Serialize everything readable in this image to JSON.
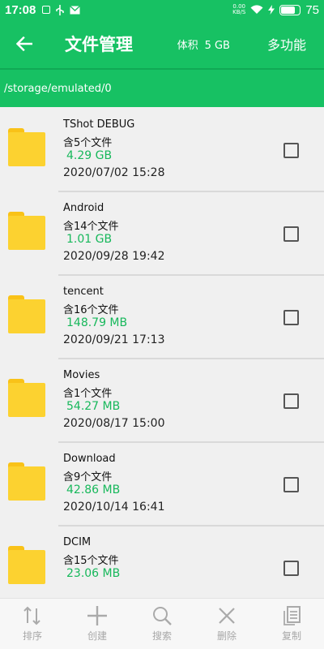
{
  "status_bar": {
    "time": "17:08",
    "net_speed_value": "0.00",
    "net_speed_unit": "KB/S",
    "battery_pct": "75",
    "battery_level": 0.75
  },
  "app_bar": {
    "title": "文件管理",
    "size_label": "体积",
    "size_value": "5 GB",
    "more_label": "多功能"
  },
  "path": "/storage/emulated/0",
  "files": [
    {
      "name": "TShot DEBUG",
      "count": "含5个文件",
      "size": "4.29 GB",
      "date": "2020/07/02 15:28"
    },
    {
      "name": "Android",
      "count": "含14个文件",
      "size": "1.01 GB",
      "date": "2020/09/28 19:42"
    },
    {
      "name": "tencent",
      "count": "含16个文件",
      "size": "148.79 MB",
      "date": "2020/09/21 17:13"
    },
    {
      "name": "Movies",
      "count": "含1个文件",
      "size": "54.27 MB",
      "date": "2020/08/17 15:00"
    },
    {
      "name": "Download",
      "count": "含9个文件",
      "size": "42.86 MB",
      "date": "2020/10/14 16:41"
    },
    {
      "name": "DCIM",
      "count": "含15个文件",
      "size": "23.06 MB",
      "date": ""
    }
  ],
  "bottom_nav": [
    {
      "label": "排序",
      "icon": "sort-icon"
    },
    {
      "label": "创建",
      "icon": "plus-icon"
    },
    {
      "label": "搜索",
      "icon": "search-icon"
    },
    {
      "label": "删除",
      "icon": "close-icon"
    },
    {
      "label": "复制",
      "icon": "copy-icon"
    }
  ],
  "colors": {
    "primary": "#17c163",
    "size_text": "#17b85b",
    "folder": "#fcd230"
  }
}
